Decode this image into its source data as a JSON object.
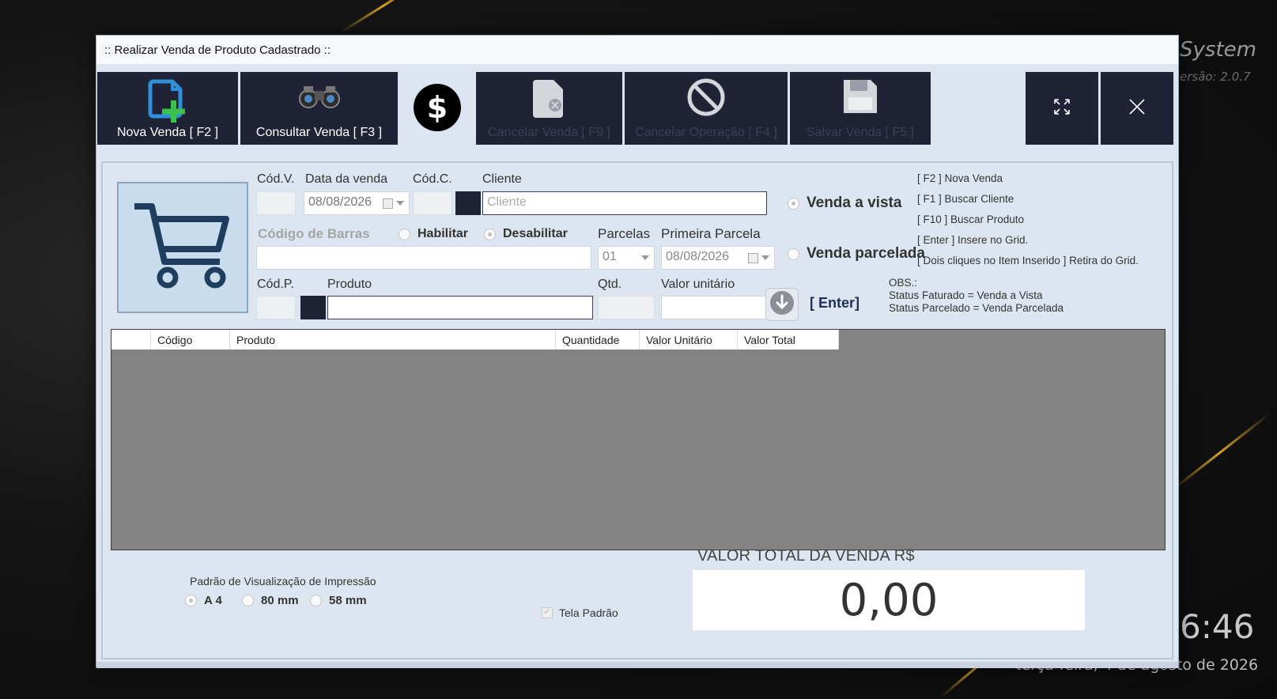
{
  "window": {
    "title": ":: Realizar Venda de Produto Cadastrado ::"
  },
  "background": {
    "brand": "System",
    "version": "ersão: 2.0.7",
    "clock": "6:46",
    "date": "terça-feira, 4 de agosto de 2026"
  },
  "toolbar": {
    "nova_venda": "Nova Venda [ F2 ]",
    "consultar_venda": "Consultar Venda [ F3 ]",
    "cancelar_venda": "Cancelar Venda [ F9 ]",
    "cancelar_operacao": "Cancelar Operação [ F4 ]",
    "salvar_venda": "Salvar Venda [ F5 ]"
  },
  "form": {
    "cod_v_label": "Cód.V.",
    "data_venda_label": "Data da venda",
    "data_venda_value": "08/08/2026",
    "cod_c_label": "Cód.C.",
    "cliente_label": "Cliente",
    "cliente_placeholder": "Cliente",
    "codigo_barras_label": "Código de Barras",
    "habilitar_label": "Habilitar",
    "desabilitar_label": "Desabilitar",
    "parcelas_label": "Parcelas",
    "parcelas_value": "01",
    "primeira_parcela_label": "Primeira Parcela",
    "primeira_parcela_value": "08/08/2026",
    "cod_p_label": "Cód.P.",
    "produto_label": "Produto",
    "qtd_label": "Qtd.",
    "valor_unitario_label": "Valor unitário",
    "venda_vista_label": "Venda a vista",
    "venda_parcelada_label": "Venda parcelada",
    "enter_label": "[ Enter]"
  },
  "shortcuts": {
    "items": [
      "[ F2 ] Nova Venda",
      "[ F1 ] Buscar Cliente",
      "[ F10 ] Buscar Produto",
      "[ Enter ] Insere no Grid.",
      "[ Dois cliques no Item Inserido ] Retira do Grid."
    ],
    "obs_title": "OBS.:",
    "obs_line1": "Status Faturado  = Venda a Vista",
    "obs_line2": "Status Parcelado = Venda Parcelada"
  },
  "grid": {
    "columns": [
      "",
      "Código",
      "Produto",
      "Quantidade",
      "Valor Unitário",
      "Valor Total"
    ]
  },
  "print": {
    "title": "Padrão de Visualização de Impressão",
    "options": [
      "A 4",
      "80 mm",
      "58 mm"
    ],
    "tela_padrao": "Tela Padrão"
  },
  "total": {
    "label": "VALOR TOTAL DA VENDA   R$",
    "value": "0,00"
  }
}
